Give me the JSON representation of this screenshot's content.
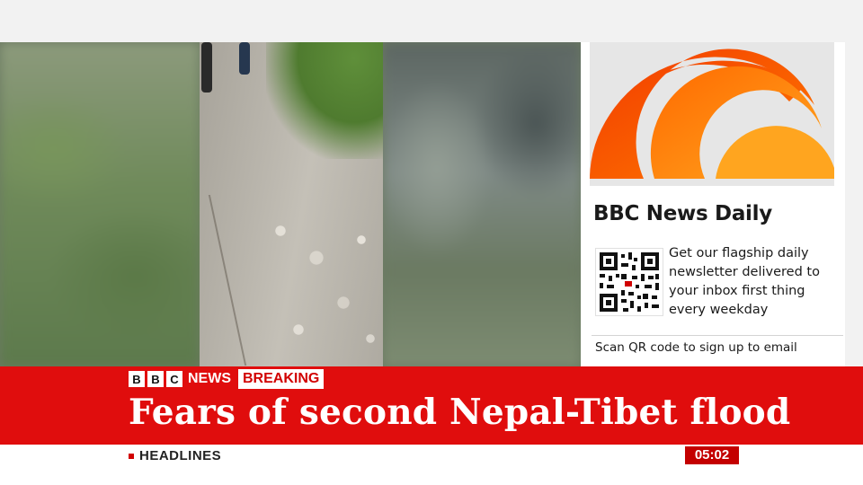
{
  "panel": {
    "title": "BBC News Daily",
    "description": "Get our flagship daily newsletter delivered to your inbox first thing every weekday",
    "scan_text": "Scan QR code to sign up to email",
    "logo_colors": [
      "#f23c00",
      "#ff7a00",
      "#ffa51f"
    ]
  },
  "lower_third": {
    "brand": {
      "letters": [
        "B",
        "B",
        "C"
      ],
      "news_label": "NEWS",
      "breaking_label": "BREAKING"
    },
    "headline": "Fears of second Nepal-Tibet flood",
    "ticker_label": "HEADLINES",
    "clock": "05:02"
  },
  "colors": {
    "breaking_red": "#e00d0d",
    "clock_red": "#c40000"
  },
  "icons": {
    "qr": "qr-code-icon",
    "logo": "bbc-news-daily-sunrise-logo"
  }
}
